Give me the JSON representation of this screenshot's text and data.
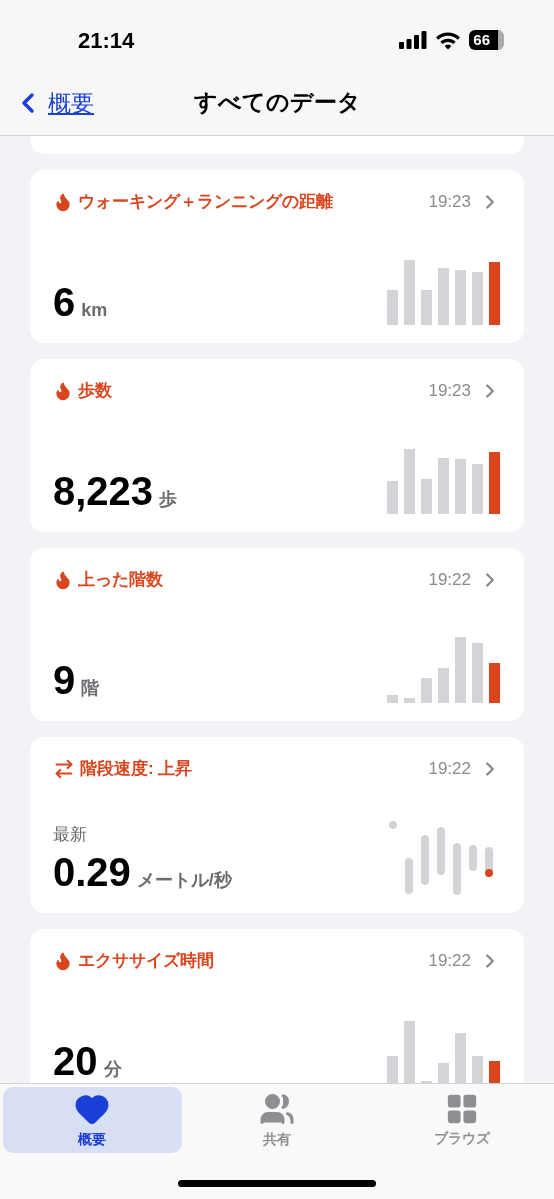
{
  "status_bar": {
    "time": "21:14",
    "battery": "66"
  },
  "nav": {
    "back": "概要",
    "title": "すべてのデータ"
  },
  "cards": [
    {
      "kind": "bars",
      "title": "ウォーキング＋ランニングの距離",
      "time": "19:23",
      "value": "6",
      "unit": "km"
    },
    {
      "kind": "bars",
      "title": "歩数",
      "time": "19:23",
      "value": "8,223",
      "unit": "歩"
    },
    {
      "kind": "bars",
      "title": "上った階数",
      "time": "19:22",
      "value": "9",
      "unit": "階"
    },
    {
      "kind": "range",
      "title": "階段速度: 上昇",
      "time": "19:22",
      "note": "最新",
      "value": "0.29",
      "unit": "メートル/秒"
    },
    {
      "kind": "bars",
      "title": "エクササイズ時間",
      "time": "19:22",
      "value": "20",
      "unit": "分"
    }
  ],
  "tabs": [
    {
      "label": "概要",
      "selected": true
    },
    {
      "label": "共有",
      "selected": false
    },
    {
      "label": "ブラウズ",
      "selected": false
    }
  ]
}
